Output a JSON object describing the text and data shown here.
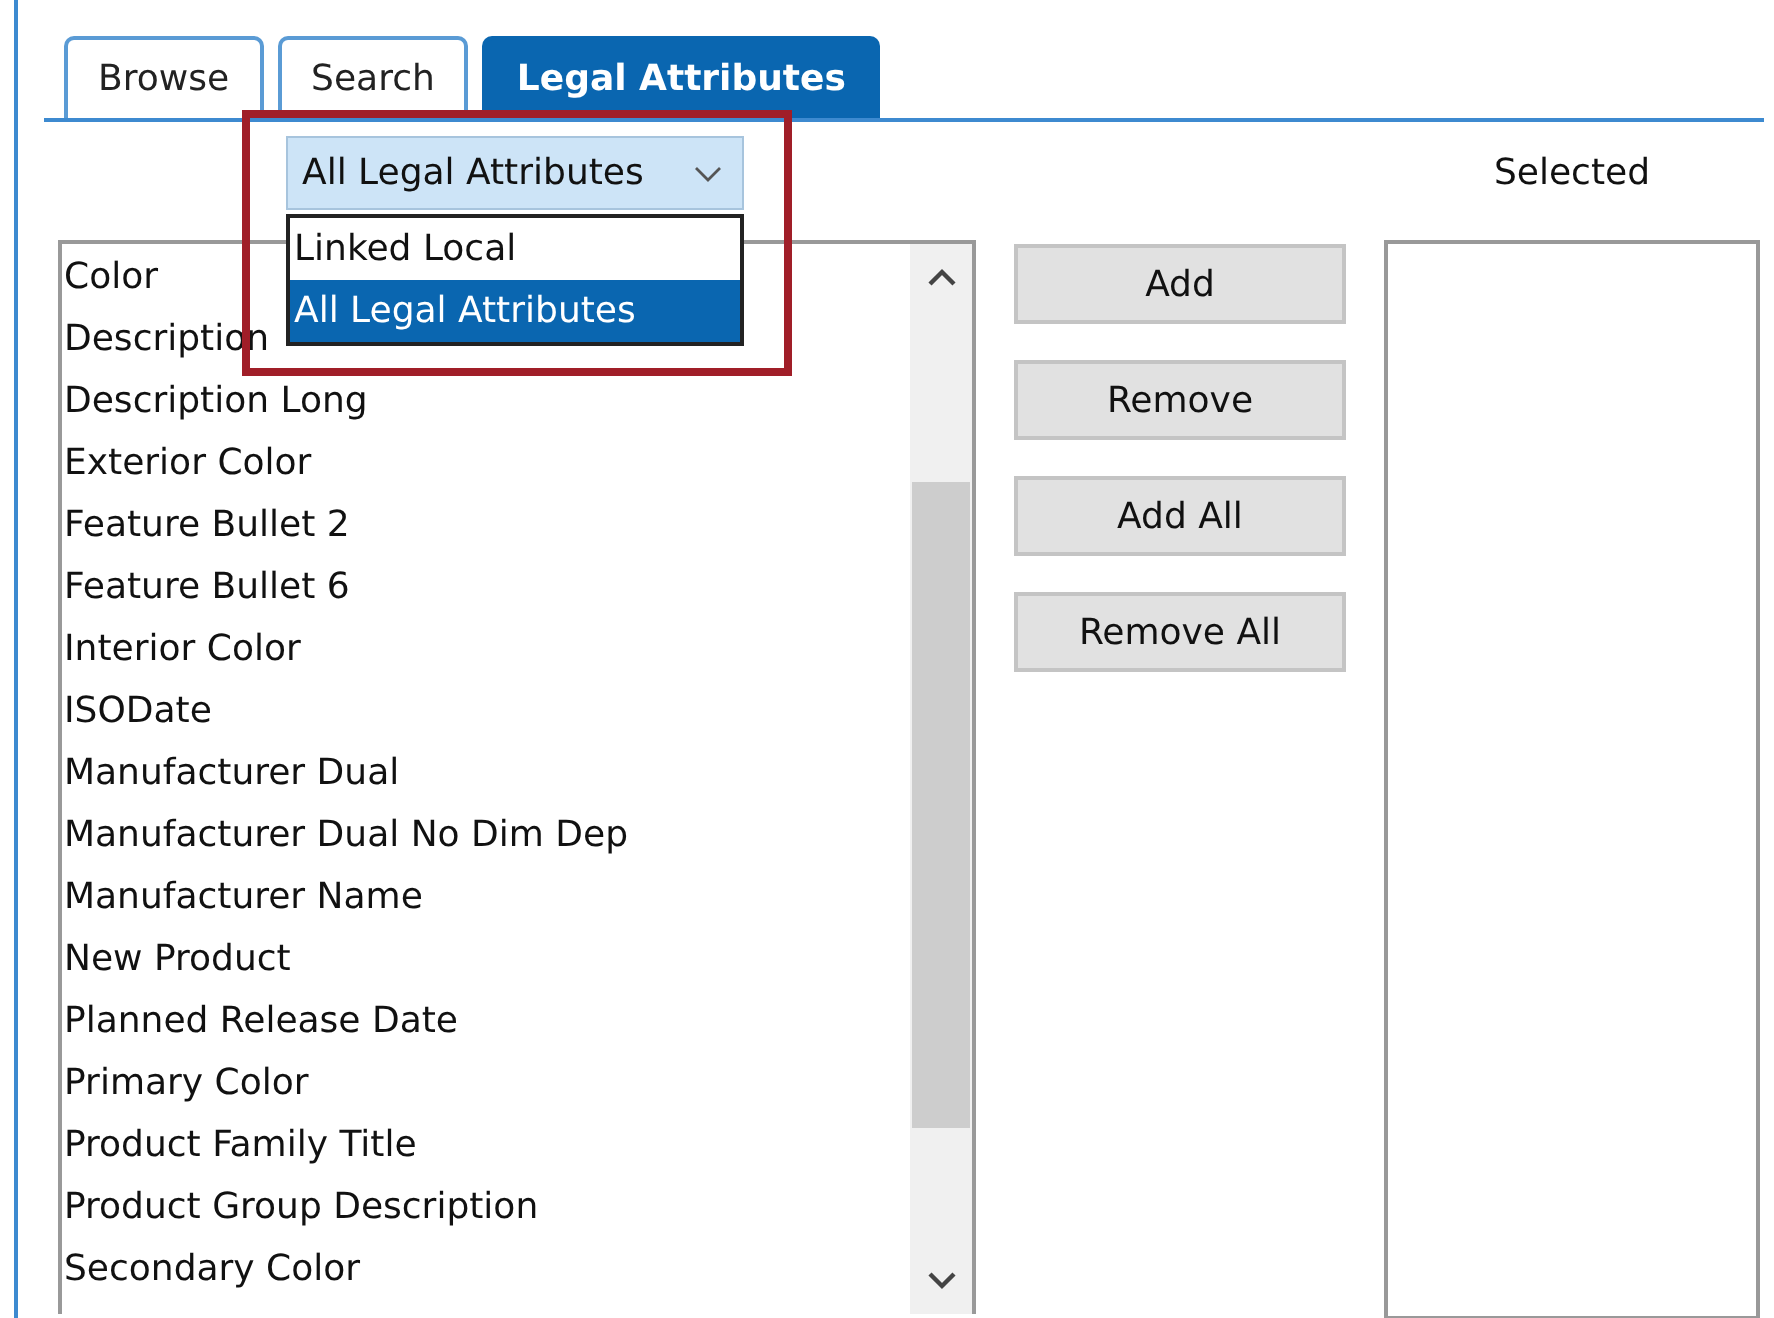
{
  "tabs": [
    {
      "label": "Browse",
      "selected": false
    },
    {
      "label": "Search",
      "selected": false
    },
    {
      "label": "Legal Attributes",
      "selected": true
    }
  ],
  "filter_dropdown": {
    "value": "All Legal Attributes",
    "expanded": true,
    "options": [
      {
        "label": "Linked Local",
        "selected": false
      },
      {
        "label": "All Legal Attributes",
        "selected": true
      }
    ]
  },
  "available_list": {
    "items": [
      {
        "label": "Color",
        "selected": false
      },
      {
        "label": "Description",
        "selected": false
      },
      {
        "label": "Description Long",
        "selected": false
      },
      {
        "label": "Exterior Color",
        "selected": false
      },
      {
        "label": "Feature Bullet 2",
        "selected": false
      },
      {
        "label": "Feature Bullet 6",
        "selected": false
      },
      {
        "label": "Interior Color",
        "selected": false
      },
      {
        "label": "ISODate",
        "selected": false
      },
      {
        "label": "Manufacturer Dual",
        "selected": false
      },
      {
        "label": "Manufacturer Dual No Dim Dep",
        "selected": false
      },
      {
        "label": "Manufacturer Name",
        "selected": false
      },
      {
        "label": "New Product",
        "selected": false
      },
      {
        "label": "Planned Release Date",
        "selected": false
      },
      {
        "label": "Primary Color",
        "selected": false
      },
      {
        "label": "Product Family Title",
        "selected": false
      },
      {
        "label": "Product Group Description",
        "selected": false
      },
      {
        "label": "Secondary Color",
        "selected": false
      }
    ]
  },
  "buttons": [
    "Add",
    "Remove",
    "Add All",
    "Remove All"
  ],
  "selected_list": {
    "label": "Selected"
  }
}
